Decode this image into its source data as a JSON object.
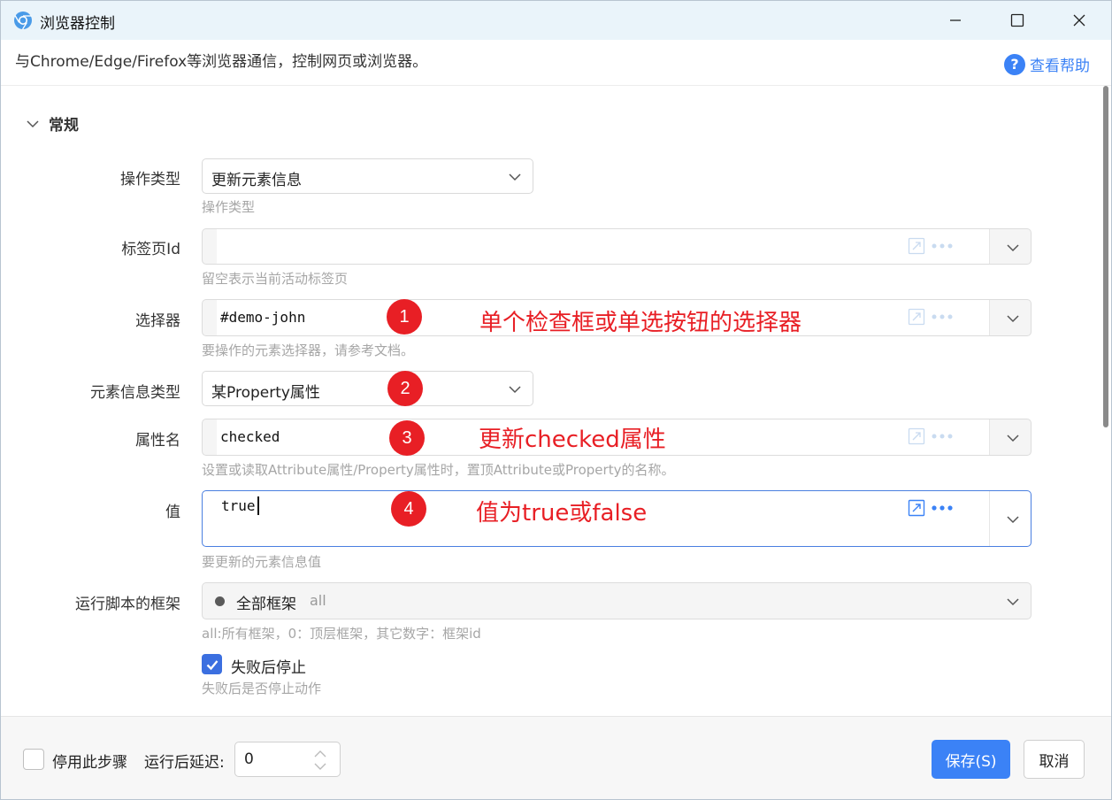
{
  "window": {
    "title": "浏览器控制",
    "description": "与Chrome/Edge/Firefox等浏览器通信，控制网页或浏览器。",
    "help_label": "查看帮助"
  },
  "section": {
    "title": "常规"
  },
  "form": {
    "operation_type": {
      "label": "操作类型",
      "value": "更新元素信息",
      "hint": "操作类型"
    },
    "tab_id": {
      "label": "标签页Id",
      "value": "",
      "hint": "留空表示当前活动标签页"
    },
    "selector": {
      "label": "选择器",
      "value": "#demo-john",
      "hint": "要操作的元素选择器，请参考文档。"
    },
    "element_info_type": {
      "label": "元素信息类型",
      "value": "某Property属性"
    },
    "property_name": {
      "label": "属性名",
      "value": "checked",
      "hint": "设置或读取Attribute属性/Property属性时，置顶Attribute或Property的名称。"
    },
    "value": {
      "label": "值",
      "value": "true",
      "hint": "要更新的元素信息值"
    },
    "frame": {
      "label": "运行脚本的框架",
      "value": "全部框架",
      "sub": "all",
      "hint": "all:所有框架，0：顶层框架，其它数字：框架id"
    },
    "stop_on_failure": {
      "label": "失败后停止",
      "checked": true,
      "hint": "失败后是否停止动作"
    }
  },
  "annotations": [
    {
      "num": "1",
      "text": "单个检查框或单选按钮的选择器"
    },
    {
      "num": "2",
      "text": ""
    },
    {
      "num": "3",
      "text": "更新checked属性"
    },
    {
      "num": "4",
      "text": "值为true或false"
    }
  ],
  "footer": {
    "disable_step_label": "停用此步骤",
    "delay_label": "运行后延迟:",
    "delay_value": "0",
    "save_label": "保存(S)",
    "cancel_label": "取消"
  },
  "colors": {
    "accent": "#3b82f6",
    "annotation": "#e81f25",
    "titlebar": "#eaf4fa"
  },
  "icons": {
    "app": "chrome-icon",
    "minimize": "minimize-icon",
    "maximize": "maximize-icon",
    "close": "close-icon",
    "help": "question-circle-icon",
    "collapse": "chevron-down-icon",
    "expand": "expand-editor-icon",
    "more": "more-dots-icon"
  }
}
